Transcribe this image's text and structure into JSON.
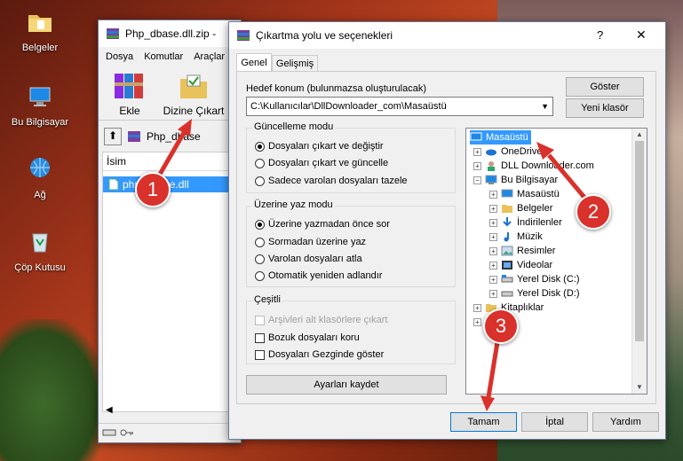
{
  "desktop": {
    "icons": [
      {
        "label": "Belgeler"
      },
      {
        "label": "Bu Bilgisayar"
      },
      {
        "label": "Ağ"
      },
      {
        "label": "Çöp Kutusu"
      }
    ]
  },
  "winrar": {
    "title": "Php_dbase.dll.zip -",
    "menu": [
      "Dosya",
      "Komutlar",
      "Araçlar"
    ],
    "toolbar": {
      "extract_label": "Ekle",
      "extract_to_label": "Dizine Çıkart"
    },
    "path": "Php_dbase",
    "column_name": "İsim",
    "file_name": "php_dbase.dll"
  },
  "dialog": {
    "title": "Çıkartma yolu ve seçenekleri",
    "help_symbol": "?",
    "close_symbol": "✕",
    "tabs": [
      "Genel",
      "Gelişmiş"
    ],
    "dest_label": "Hedef konum (bulunmazsa oluşturulacak)",
    "dest_value": "C:\\Kullanıcılar\\DllDownloader_com\\Masaüstü",
    "show_button": "Göster",
    "new_folder_button": "Yeni klasör",
    "update_mode": {
      "title": "Güncelleme modu",
      "options": [
        "Dosyaları çıkart ve değiştir",
        "Dosyaları çıkart ve güncelle",
        "Sadece varolan dosyaları tazele"
      ]
    },
    "overwrite_mode": {
      "title": "Üzerine yaz modu",
      "options": [
        "Üzerine yazmadan önce sor",
        "Sormadan üzerine yaz",
        "Varolan dosyaları atla",
        "Otomatik yeniden adlandır"
      ]
    },
    "misc": {
      "title": "Çeşitli",
      "options": [
        "Arşivleri alt klasörlere çıkart",
        "Bozuk dosyaları koru",
        "Dosyaları Gezginde göster"
      ]
    },
    "save_settings_button": "Ayarları kaydet",
    "tree": [
      {
        "label": "Masaüstü"
      },
      {
        "label": "OneDrive"
      },
      {
        "label": "DLL Downloader.com"
      },
      {
        "label": "Bu Bilgisayar"
      },
      {
        "label": "Masaüstü"
      },
      {
        "label": "Belgeler"
      },
      {
        "label": "İndirilenler"
      },
      {
        "label": "Müzik"
      },
      {
        "label": "Resimler"
      },
      {
        "label": "Videolar"
      },
      {
        "label": "Yerel Disk (C:)"
      },
      {
        "label": "Yerel Disk (D:)"
      },
      {
        "label": "Kitaplıklar"
      },
      {
        "label": "Ağ"
      }
    ],
    "ok_button": "Tamam",
    "cancel_button": "İptal",
    "help_button": "Yardım"
  },
  "annotations": {
    "step1": "1",
    "step2": "2",
    "step3": "3"
  },
  "colors": {
    "accent": "#0078d7",
    "selection": "#3399ff",
    "annotation_red": "#d9312b"
  }
}
